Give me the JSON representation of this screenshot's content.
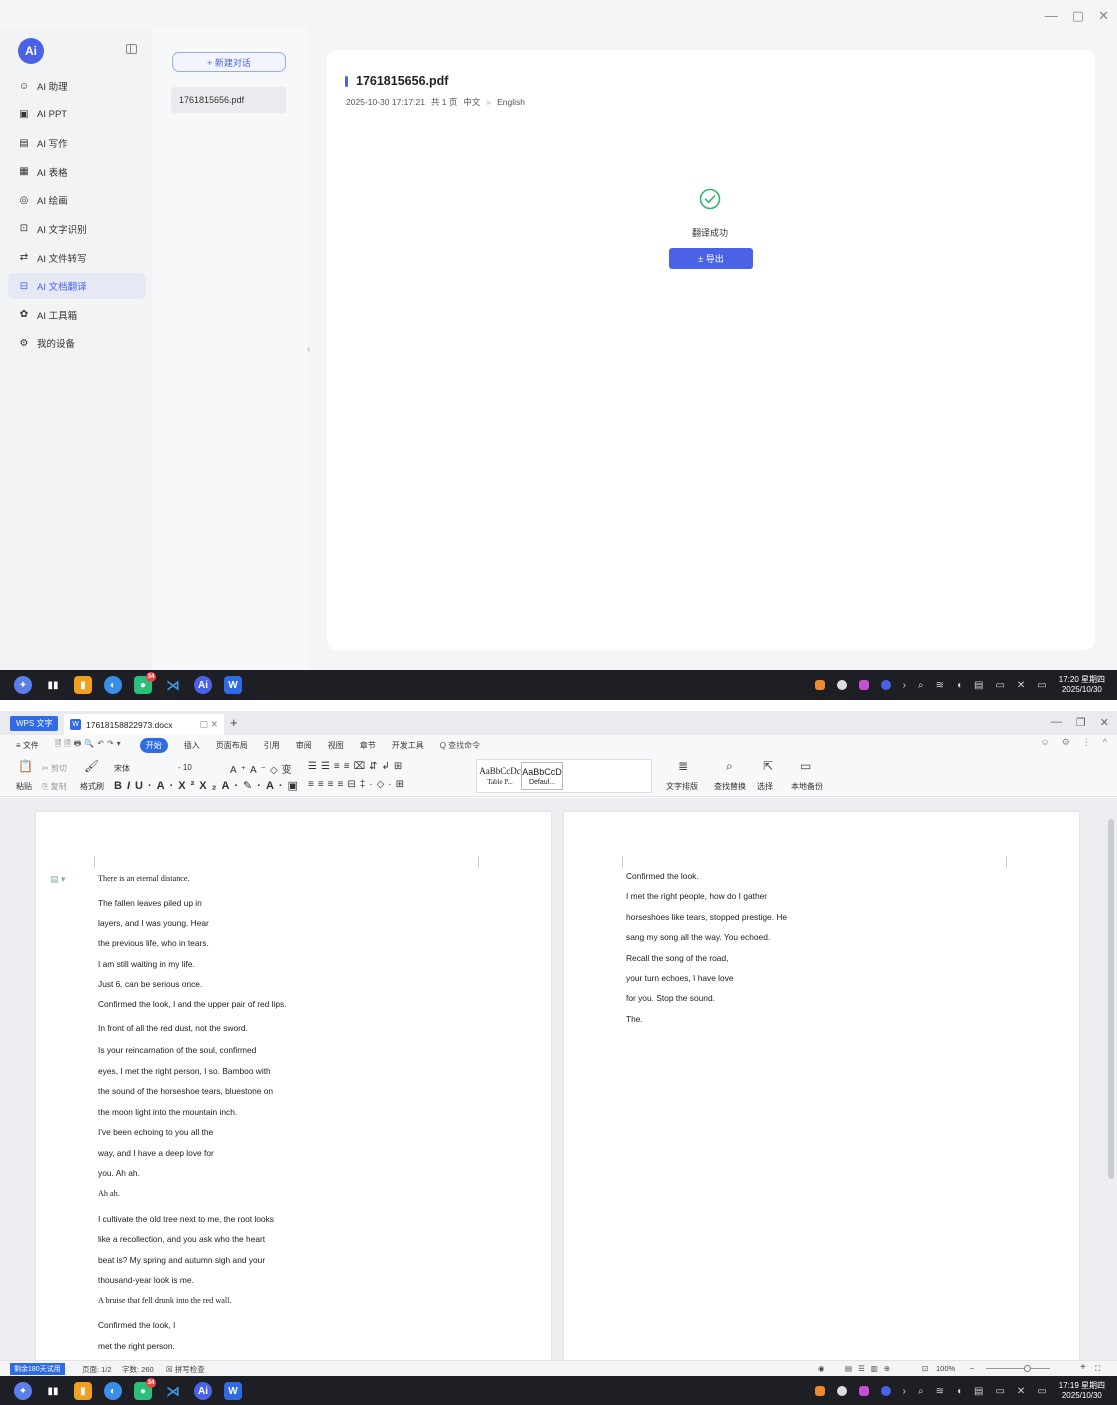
{
  "ai_app": {
    "logo_text": "Ai",
    "nav_items": [
      {
        "label": "AI 助理",
        "icon": "robot-icon",
        "active": false
      },
      {
        "label": "AI PPT",
        "icon": "ppt-icon",
        "active": false
      },
      {
        "label": "AI 写作",
        "icon": "writing-icon",
        "active": false
      },
      {
        "label": "AI 表格",
        "icon": "table-icon",
        "active": false
      },
      {
        "label": "AI 绘画",
        "icon": "palette-icon",
        "active": false
      },
      {
        "label": "AI 文字识别",
        "icon": "ocr-icon",
        "active": false
      },
      {
        "label": "AI 文件转写",
        "icon": "transcribe-icon",
        "active": false
      },
      {
        "label": "AI 文档翻译",
        "icon": "translate-icon",
        "active": true
      },
      {
        "label": "AI 工具箱",
        "icon": "toolbox-icon",
        "active": false
      },
      {
        "label": "我的设备",
        "icon": "device-icon",
        "active": false
      }
    ],
    "new_chat_label": "+ 新建对话",
    "conversations": [
      "1761815656.pdf"
    ],
    "file": {
      "name": "1761815656.pdf",
      "datetime": "2025-10-30 17:17:21",
      "pages": "共 1 页",
      "source_lang": "中文",
      "target_lang": "English"
    },
    "status_text": "翻译成功",
    "export_label": "± 导出",
    "accent_color": "#4a63e6"
  },
  "taskbar_top": {
    "time": "17:20 星期四",
    "date": "2025/10/30",
    "badge": "34"
  },
  "wps": {
    "app_tab": "WPS 文字",
    "doc_tab": "17618158822973.docx",
    "menus": [
      "≡ 文件",
      "开始",
      "插入",
      "页面布局",
      "引用",
      "审阅",
      "视图",
      "章节",
      "开发工具"
    ],
    "search_label": "Q 查找命令",
    "ribbon": {
      "paste": "粘贴",
      "cut": "剪切",
      "copy": "复制",
      "format_painter": "格式刷",
      "font": "宋体",
      "font_size": "- 10",
      "style1_preview": "AaBbCcDc",
      "style1_name": "Table P...",
      "style2_preview": "AaBbCcD",
      "style2_name": "Defaul...",
      "text_layout": "文字排版",
      "find_replace": "查找替换",
      "select": "选择",
      "local_backup": "本地备份"
    },
    "page1_lines": [
      {
        "text": "There is an eternal distance.",
        "serif": true
      },
      {
        "text": "The fallen leaves piled up in",
        "serif": false
      },
      {
        "text": "layers, and I was young. Hear",
        "serif": false
      },
      {
        "text": "the previous life, who in tears.",
        "serif": false
      },
      {
        "text": "I am still waiting in my life.",
        "serif": false
      },
      {
        "text": "Just 6. can be serious once.",
        "serif": false
      },
      {
        "text": "Confirmed the look, I and the upper pair of red lips.",
        "serif": false
      },
      {
        "text": "In front of all the red dust, not the sword.",
        "serif": false
      },
      {
        "text": "Is your reincarnation of the soul, confirmed",
        "serif": false
      },
      {
        "text": "eyes, I met the right person, I so. Bamboo with",
        "serif": false
      },
      {
        "text": "the sound of the horseshoe tears, bluestone on",
        "serif": false
      },
      {
        "text": "the moon light into the mountain inch.",
        "serif": false
      },
      {
        "text": "I've been echoing to you all the",
        "serif": false
      },
      {
        "text": "way, and I have a deep love for",
        "serif": false
      },
      {
        "text": "you. Ah ah.",
        "serif": false
      },
      {
        "text": "Ah ah.",
        "serif": true
      },
      {
        "text": "I cultivate the old tree next to me, the root looks",
        "serif": false
      },
      {
        "text": "like a recollection, and you ask who the heart",
        "serif": false
      },
      {
        "text": "beat is? My spring and autumn sigh and your",
        "serif": false
      },
      {
        "text": "thousand-year look is me.",
        "serif": false
      },
      {
        "text": "A bruise that fell drunk into the red wall.",
        "serif": true
      },
      {
        "text": "Confirmed the look, I",
        "serif": false
      },
      {
        "text": "met the right person.",
        "serif": false
      }
    ],
    "page2_lines": [
      "Confirmed the look.",
      "I met the right people, how do I gather",
      "horseshoes like tears, stopped prestige. He",
      "sang my song all the way. You echoed.",
      "Recall the song of the road,",
      "your turn echoes, I have love",
      "for you. Stop the sound.",
      "The."
    ],
    "status": {
      "trial": "剩余180天试用",
      "page": "页面: 1/2",
      "words": "字数: 260",
      "spell": "拼写检查",
      "zoom": "100%"
    },
    "accent_color": "#2f6be4"
  },
  "taskbar_bottom": {
    "time": "17:19 星期四",
    "date": "2025/10/30",
    "badge": "34"
  }
}
